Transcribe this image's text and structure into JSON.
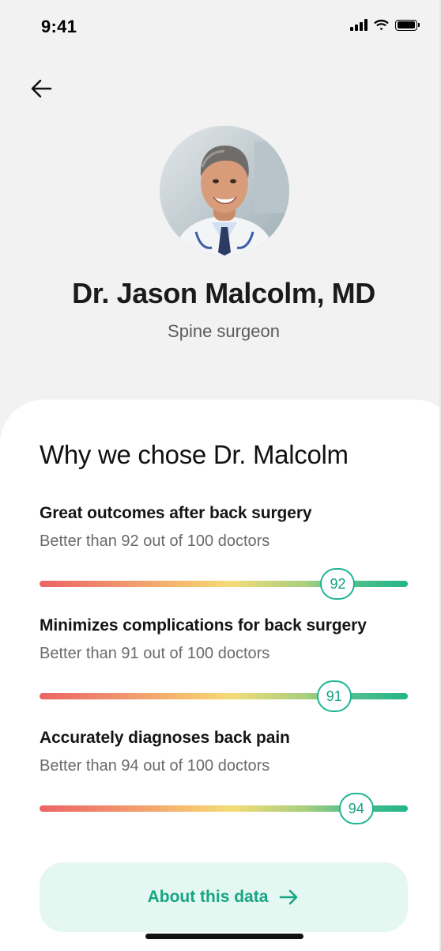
{
  "status_bar": {
    "time": "9:41"
  },
  "doctor": {
    "name": "Dr. Jason Malcolm, MD",
    "specialty": "Spine surgeon"
  },
  "card": {
    "title": "Why we chose Dr. Malcolm",
    "metrics": [
      {
        "title": "Great outcomes after back surgery",
        "subtitle": "Better than 92 out of 100 doctors",
        "score": "92",
        "fraction": 0.81
      },
      {
        "title": "Minimizes complications for back surgery",
        "subtitle": "Better than 91 out of 100 doctors",
        "score": "91",
        "fraction": 0.8
      },
      {
        "title": "Accurately diagnoses back pain",
        "subtitle": "Better than 94 out of 100 doctors",
        "score": "94",
        "fraction": 0.86
      }
    ]
  },
  "about_button": {
    "label": "About this data"
  },
  "colors": {
    "accent": "#1fb491",
    "accent_text": "#17a583",
    "button_bg": "#e4f7f1"
  }
}
